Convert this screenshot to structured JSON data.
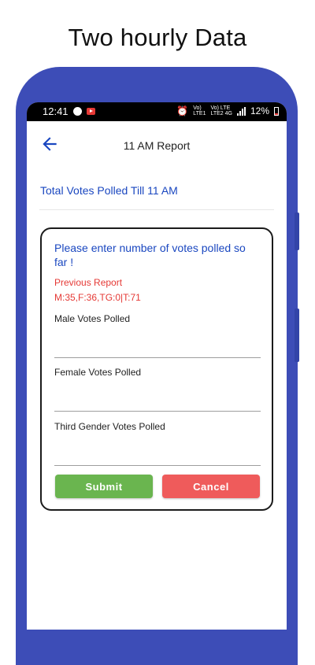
{
  "promo_title": "Two hourly Data",
  "status_bar": {
    "time": "12:41",
    "battery": "12%",
    "net1_top": "Vo)",
    "net1_bottom": "LTE1",
    "net2_top": "Vo) LTE",
    "net2_bottom": "LTE2 4G"
  },
  "app_bar": {
    "title": "11 AM Report",
    "back_icon": "arrow-back-icon"
  },
  "total_votes_label": "Total Votes Polled Till 11 AM",
  "form": {
    "heading": "Please enter number of votes polled so far !",
    "previous_report_title": "Previous Report",
    "previous_report_value": "M:35,F:36,TG:0|T:71",
    "male_label": "Male Votes Polled",
    "male_value": "",
    "female_label": "Female Votes Polled",
    "female_value": "",
    "third_label": "Third Gender Votes Polled",
    "third_value": "",
    "submit_label": "Submit",
    "cancel_label": "Cancel"
  },
  "colors": {
    "frame": "#3d4db7",
    "accent_blue": "#1a47c0",
    "error_red": "#e53935",
    "submit_green": "#6ab54f",
    "cancel_red": "#ef5b5b"
  }
}
